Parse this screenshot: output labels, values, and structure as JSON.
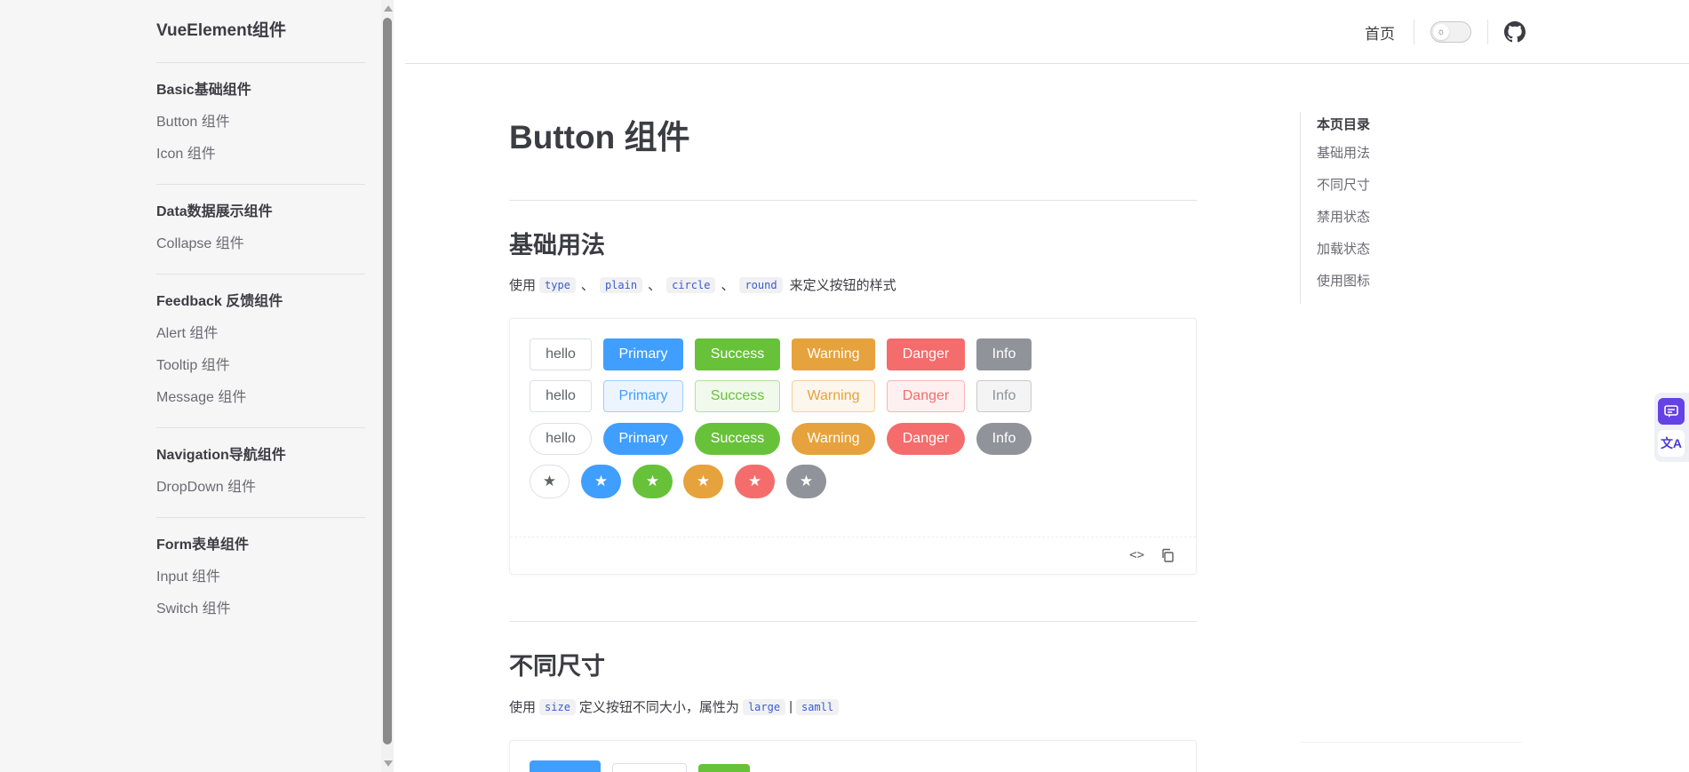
{
  "sidebar": {
    "site_title": "VueElement组件",
    "groups": [
      {
        "title": "Basic基础组件",
        "items": [
          "Button 组件",
          "Icon 组件"
        ]
      },
      {
        "title": "Data数据展示组件",
        "items": [
          "Collapse 组件"
        ]
      },
      {
        "title": "Feedback 反馈组件",
        "items": [
          "Alert 组件",
          "Tooltip 组件",
          "Message 组件"
        ]
      },
      {
        "title": "Navigation导航组件",
        "items": [
          "DropDown 组件"
        ]
      },
      {
        "title": "Form表单组件",
        "items": [
          "Input 组件",
          "Switch 组件"
        ]
      }
    ]
  },
  "topnav": {
    "home_label": "首页",
    "theme_icon": "sun-icon",
    "github_icon": "github-icon"
  },
  "content": {
    "page_title": "Button 组件",
    "section1": {
      "title": "基础用法",
      "desc_prefix": "使用",
      "codes": [
        "type",
        "plain",
        "circle",
        "round"
      ],
      "sep": "、",
      "desc_suffix": "来定义按钮的样式"
    },
    "demo": {
      "rows": {
        "default": [
          "hello",
          "Primary",
          "Success",
          "Warning",
          "Danger",
          "Info"
        ],
        "plain": [
          "hello",
          "Primary",
          "Success",
          "Warning",
          "Danger",
          "Info"
        ],
        "round": [
          "hello",
          "Primary",
          "Success",
          "Warning",
          "Danger",
          "Info"
        ],
        "circle_icon": "star-icon",
        "circle_glyph": "★"
      },
      "code_icon_glyph": "<>"
    },
    "section2": {
      "title": "不同尺寸",
      "desc_prefix": "使用",
      "code1": "size",
      "desc_mid": "定义按钮不同大小，属性为",
      "code2": "large",
      "pipe": "|",
      "code3": "samll"
    }
  },
  "toc": {
    "title": "本页目录",
    "items": [
      "基础用法",
      "不同尺寸",
      "禁用状态",
      "加载状态",
      "使用图标"
    ]
  },
  "floating": {
    "icon1": "chat-icon",
    "icon2": "translate-icon",
    "icon2_glyph": "文A"
  },
  "colors": {
    "primary": "#409eff",
    "success": "#67c23a",
    "warning": "#e6a23c",
    "danger": "#f56c6c",
    "info": "#909399",
    "accent": "#6542e6"
  }
}
